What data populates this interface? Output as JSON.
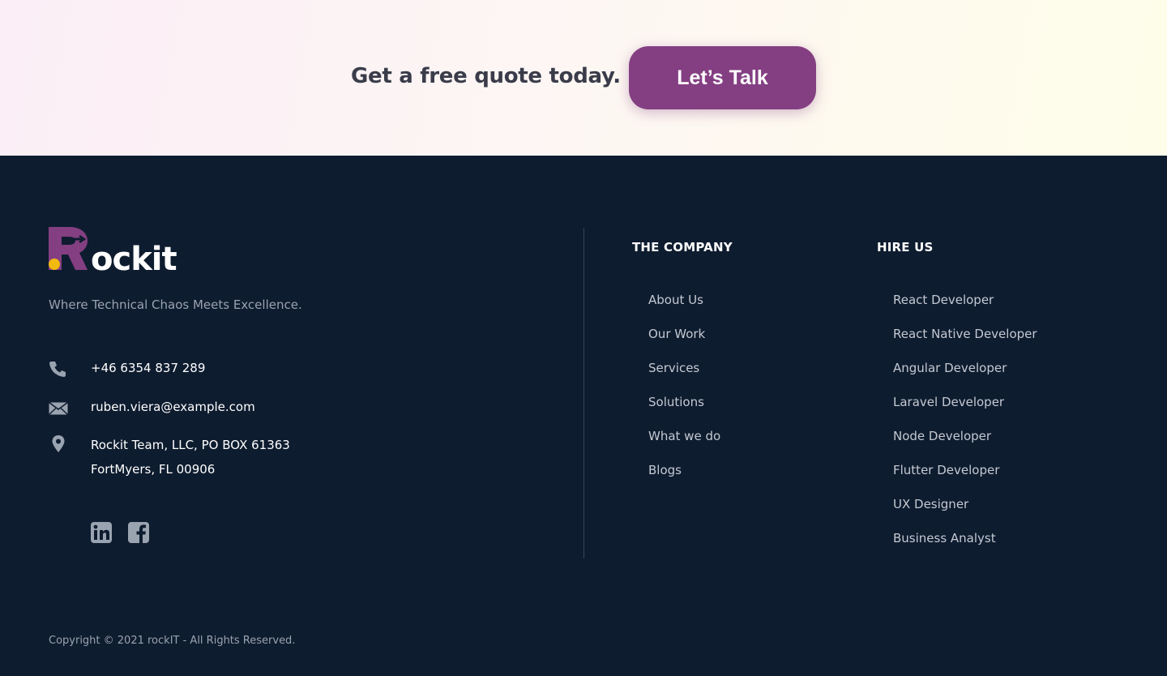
{
  "cta": {
    "text": "Get a free quote today.",
    "button_label": "Let’s Talk",
    "button_color": "#843f82"
  },
  "brand": {
    "logo_text": "Rockit",
    "tagline": "Where Technical Chaos Meets Excellence.",
    "accent_purple": "#843f82",
    "accent_yellow": "#f2b90f"
  },
  "contact": {
    "phone": "+46 6354 837 289",
    "email": "ruben.viera@example.com",
    "address_line1": "Rockit Team, LLC, PO BOX 61363",
    "address_line2": "FortMyers, FL 00906",
    "phone_icon": "phone-icon",
    "email_icon": "envelope-icon",
    "address_icon": "map-pin-icon"
  },
  "socials": [
    {
      "icon": "linkedin-icon"
    },
    {
      "icon": "facebook-icon"
    }
  ],
  "company": {
    "heading": "THE COMPANY",
    "links": [
      "About Us",
      "Our Work",
      "Services",
      "Solutions",
      "What we do",
      "Blogs"
    ]
  },
  "hire": {
    "heading": "HIRE US",
    "links": [
      "React Developer",
      "React Native Developer",
      "Angular Developer",
      "Laravel Developer",
      "Node Developer",
      "Flutter Developer",
      "UX Designer",
      "Business Analyst"
    ]
  },
  "copyright": "Copyright © 2021 rockIT - All Rights Reserved.",
  "colors": {
    "footer_bg": "#0e1c2f",
    "link_text": "#c4c9d2",
    "muted_text": "#9aa3b0"
  }
}
